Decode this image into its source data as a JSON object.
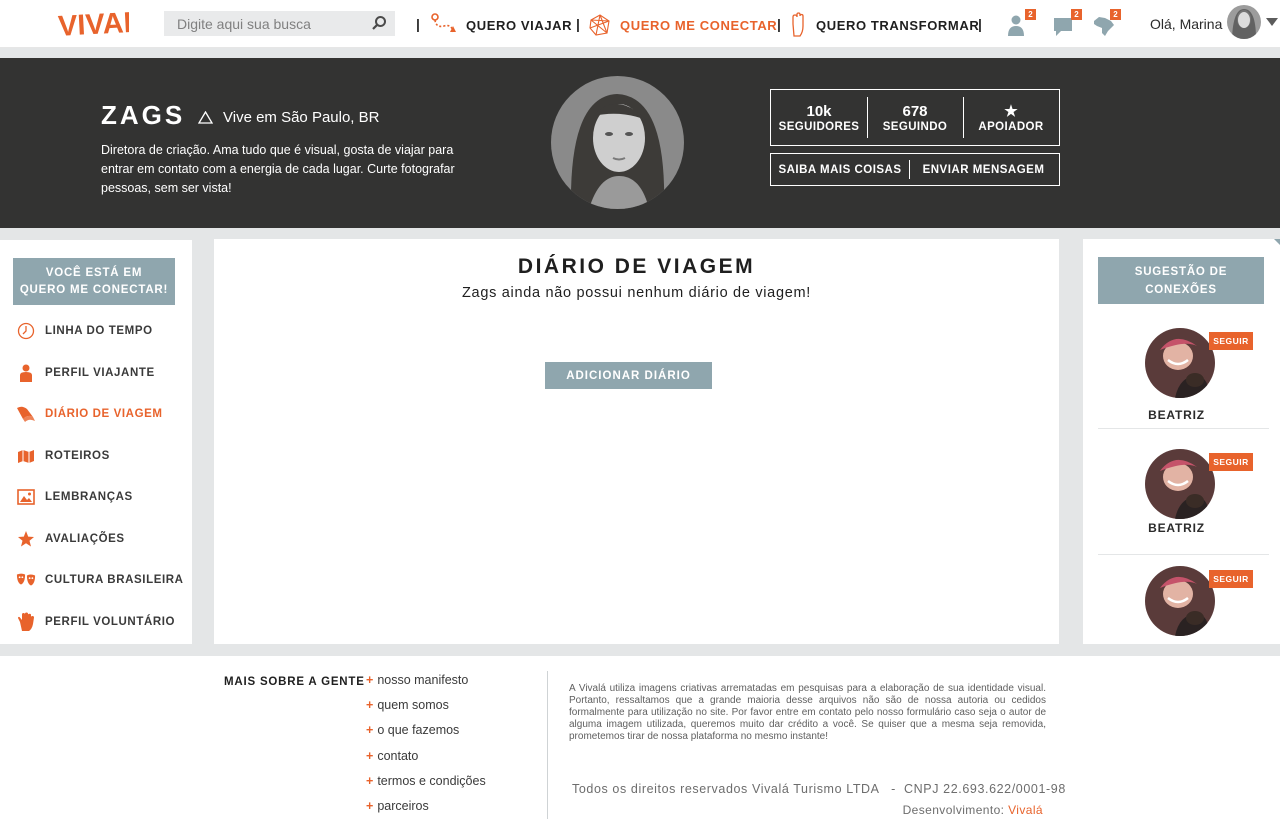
{
  "header": {
    "logo_text": "VIVALÁ",
    "search_placeholder": "Digite aqui sua busca",
    "nav": [
      {
        "label": "QUERO VIAJAR",
        "icon": "route-icon"
      },
      {
        "label": "QUERO ME CONECTAR",
        "icon": "network-icon",
        "active": true
      },
      {
        "label": "QUERO TRANSFORMAR",
        "icon": "hand-icon"
      }
    ],
    "notifications": [
      {
        "icon": "user-icon",
        "count": "2"
      },
      {
        "icon": "chat-icon",
        "count": "2"
      },
      {
        "icon": "brazil-map-icon",
        "count": "2"
      }
    ],
    "greeting": "Olá, Marina"
  },
  "profile": {
    "name": "ZAGS",
    "location": "Vive em São Paulo, BR",
    "bio": "Diretora de criação. Ama tudo que é visual, gosta de viajar para entrar em contato com a energia de cada lugar. Curte fotografar pessoas, sem ser vista!",
    "stats": [
      {
        "value": "10k",
        "label": "SEGUIDORES"
      },
      {
        "value": "678",
        "label": "SEGUINDO"
      },
      {
        "value": "★",
        "label": "APOIADOR"
      }
    ],
    "actions": [
      "SAIBA MAIS COISAS",
      "ENVIAR MENSAGEM"
    ]
  },
  "sidebar": {
    "context_line1": "VOCÊ ESTÁ EM",
    "context_line2": "QUERO ME CONECTAR!",
    "items": [
      {
        "label": "LINHA DO TEMPO",
        "icon": "clock-icon"
      },
      {
        "label": "PERFIL VIAJANTE",
        "icon": "person-icon"
      },
      {
        "label": "DIÁRIO DE VIAGEM",
        "icon": "book-icon",
        "active": true
      },
      {
        "label": "ROTEIROS",
        "icon": "map-icon"
      },
      {
        "label": "LEMBRANÇAS",
        "icon": "picture-icon"
      },
      {
        "label": "AVALIAÇÕES",
        "icon": "star-icon"
      },
      {
        "label": "CULTURA BRASILEIRA",
        "icon": "masks-icon"
      },
      {
        "label": "PERFIL VOLUNTÁRIO",
        "icon": "raised-hand-icon"
      }
    ]
  },
  "main": {
    "title": "DIÁRIO DE VIAGEM",
    "empty_message": "Zags ainda não possui nenhum diário de viagem!",
    "add_button": "ADICIONAR DIÁRIO"
  },
  "suggestions": {
    "title_line1": "SUGESTÃO DE",
    "title_line2": "CONEXÕES",
    "follow_label": "SEGUIR",
    "people": [
      {
        "name": "BEATRIZ"
      },
      {
        "name": "BEATRIZ"
      },
      {
        "name": ""
      }
    ]
  },
  "footer": {
    "heading": "MAIS SOBRE A GENTE",
    "links": [
      "nosso manifesto",
      "quem somos",
      "o que fazemos",
      "contato",
      "termos e condições",
      "parceiros"
    ],
    "disclaimer": "A Vivalá utiliza imagens criativas arrematadas em pesquisas para a elaboração de sua identidade visual. Portanto, ressaltamos que a grande maioria desse arquivos não são de nossa autoria ou cedidos formalmente para utilização no site. Por favor entre em contato pelo nosso formulário caso seja o autor de alguma imagem utilizada, queremos muito dar crédito a você. Se quiser que a mesma seja removida, prometemos tirar de nossa plataforma no mesmo instante!",
    "rights": "Todos os direitos reservados Vivalá Turismo LTDA   -  CNPJ 22.693.622/0001-98",
    "dev_prefix": "Desenvolvimento:",
    "dev_name": "Vivalá"
  },
  "colors": {
    "accent": "#e8632c",
    "slate": "#8fa6ae",
    "hero_bg": "#333332",
    "page_bg": "#e4e6e7"
  }
}
